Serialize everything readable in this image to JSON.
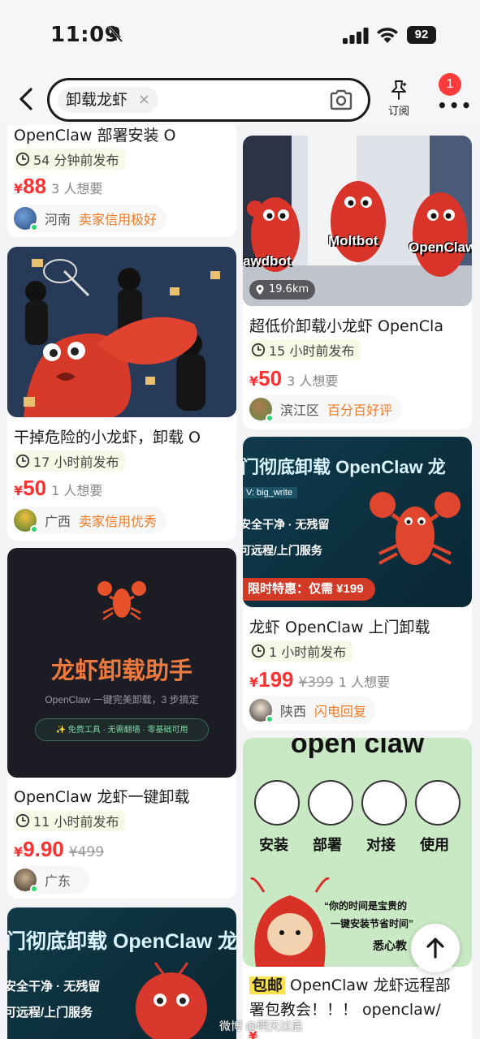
{
  "status_bar": {
    "time": "11:09",
    "battery": "92"
  },
  "search": {
    "query": "卸载龙虾",
    "clear": "×",
    "subscribe_label": "订阅",
    "notification_count": "1"
  },
  "colors": {
    "price": "#ff3030",
    "seller_tag": "#f07a24",
    "online": "#2ed573",
    "badge": "#ff3b3b"
  },
  "left_cards": [
    {
      "title": "OpenClaw 部署安装 O",
      "time": "54 分钟前发布",
      "currency": "¥",
      "price": "88",
      "original_price": "",
      "want": "3 人想要",
      "region": "河南",
      "seller_tag": "卖家信用极好"
    },
    {
      "title": "干掉危险的小龙虾，卸载 O",
      "time": "17 小时前发布",
      "currency": "¥",
      "price": "50",
      "original_price": "",
      "want": "1 人想要",
      "region": "广西",
      "seller_tag": "卖家信用优秀"
    },
    {
      "title": "OpenClaw 龙虾一键卸载",
      "time": "11 小时前发布",
      "currency": "¥",
      "price": "9.90",
      "original_price": "¥499",
      "want": "",
      "region": "广东",
      "seller_tag": "",
      "image_text": {
        "headline": "龙虾卸载助手",
        "sub": "OpenClaw 一键完美卸载，3 步搞定",
        "pill": "✨ 免费工具 · 无需翻墙 · 零基础可用"
      }
    },
    {
      "image_text": {
        "headline": "门彻底卸载 OpenClaw 龙",
        "line1": "安全干净 · 无残留",
        "line2": "可远程/上门服务"
      }
    }
  ],
  "right_cards": [
    {
      "title": "超低价卸载小龙虾 OpenCla",
      "time": "15 小时前发布",
      "currency": "¥",
      "price": "50",
      "original_price": "",
      "want": "3 人想要",
      "region": "滨江区",
      "seller_tag": "百分百好评",
      "image_text": {
        "label_a": "awdbot",
        "label_b": "Moltbot",
        "label_c": "OpenClaw",
        "distance": "19.6km"
      }
    },
    {
      "title": "龙虾 OpenClaw 上门卸载",
      "time": "1 小时前发布",
      "currency": "¥",
      "price": "199",
      "original_price": "¥399",
      "want": "1 人想要",
      "region": "陕西",
      "seller_tag": "闪电回复",
      "image_text": {
        "headline": "门彻底卸载 OpenClaw 龙",
        "wechat": "V: big_write",
        "line1": "安全干净 · 无残留",
        "line2": "可远程/上门服务",
        "promo": "限时特惠：仅需 ¥199"
      }
    },
    {
      "title_tag": "包邮",
      "title": " OpenClaw 龙虾远程部",
      "title_line2": "署包教会！！！ openclaw/",
      "image_text": {
        "headline": "open claw",
        "steps": [
          "安装",
          "部署",
          "对接",
          "使用"
        ],
        "quote1": "“你的时间是宝贵的",
        "quote2": "一键安装节省时间”",
        "sign": "悉心教"
      }
    }
  ],
  "watermark": "微博 @明天过后"
}
